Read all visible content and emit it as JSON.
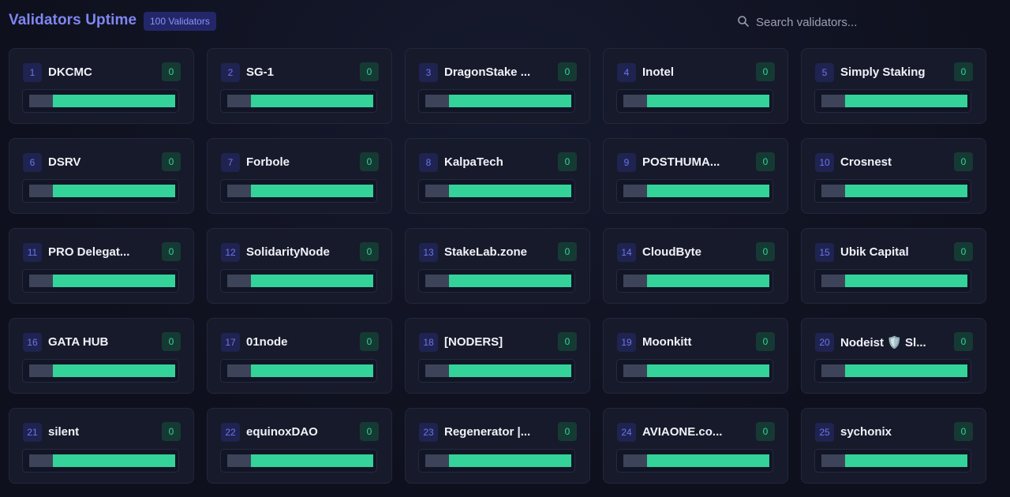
{
  "header": {
    "title": "Validators Uptime",
    "badge": "100 Validators"
  },
  "search": {
    "placeholder": "Search validators..."
  },
  "colors": {
    "accent": "#7f86f2",
    "uptime_green": "#34d399",
    "missed_gray": "#3d4459",
    "card_bg": "#171a2b"
  },
  "validators": [
    {
      "rank": "1",
      "name": "DKCMC",
      "score": "0"
    },
    {
      "rank": "2",
      "name": "SG-1",
      "score": "0"
    },
    {
      "rank": "3",
      "name": "DragonStake ...",
      "score": "0"
    },
    {
      "rank": "4",
      "name": "Inotel",
      "score": "0"
    },
    {
      "rank": "5",
      "name": "Simply Staking",
      "score": "0"
    },
    {
      "rank": "6",
      "name": "DSRV",
      "score": "0"
    },
    {
      "rank": "7",
      "name": "Forbole",
      "score": "0"
    },
    {
      "rank": "8",
      "name": "KalpaTech",
      "score": "0"
    },
    {
      "rank": "9",
      "name": "POSTHUMA...",
      "score": "0"
    },
    {
      "rank": "10",
      "name": "Crosnest",
      "score": "0"
    },
    {
      "rank": "11",
      "name": "PRO Delegat...",
      "score": "0"
    },
    {
      "rank": "12",
      "name": "SolidarityNode",
      "score": "0"
    },
    {
      "rank": "13",
      "name": "StakeLab.zone",
      "score": "0"
    },
    {
      "rank": "14",
      "name": "CloudByte",
      "score": "0"
    },
    {
      "rank": "15",
      "name": "Ubik Capital",
      "score": "0"
    },
    {
      "rank": "16",
      "name": "GATA HUB",
      "score": "0"
    },
    {
      "rank": "17",
      "name": "01node",
      "score": "0"
    },
    {
      "rank": "18",
      "name": "[NODERS]",
      "score": "0"
    },
    {
      "rank": "19",
      "name": "Moonkitt",
      "score": "0"
    },
    {
      "rank": "20",
      "name": "Nodeist 🛡️ Sl...",
      "score": "0"
    },
    {
      "rank": "21",
      "name": "silent",
      "score": "0"
    },
    {
      "rank": "22",
      "name": "equinoxDAO",
      "score": "0"
    },
    {
      "rank": "23",
      "name": "Regenerator |...",
      "score": "0"
    },
    {
      "rank": "24",
      "name": "AVIAONE.co...",
      "score": "0"
    },
    {
      "rank": "25",
      "name": "sychonix",
      "score": "0"
    }
  ]
}
